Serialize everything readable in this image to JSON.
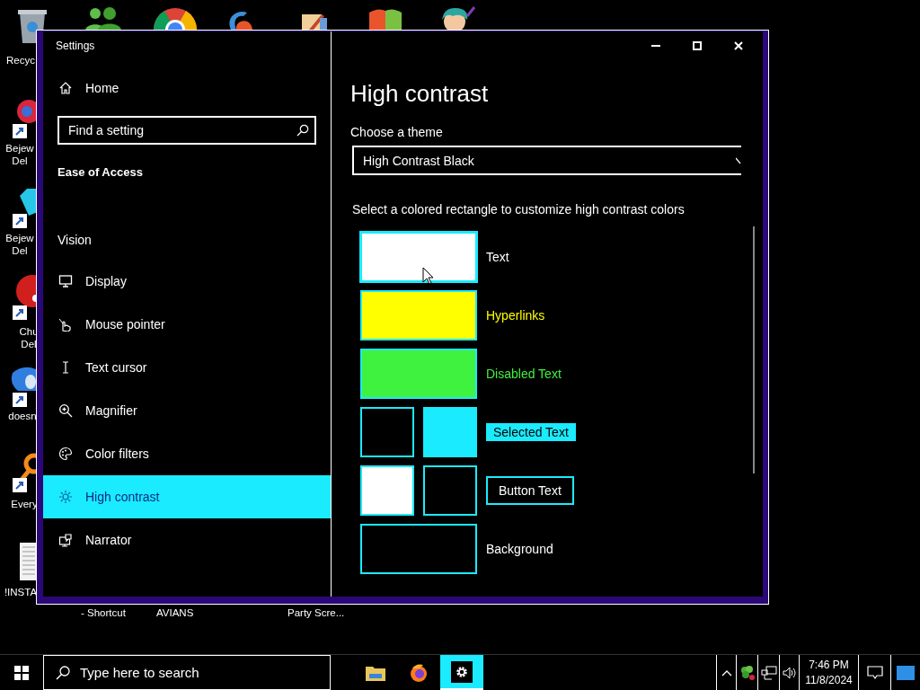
{
  "desktop": {
    "side_labels": [
      {
        "text": "Recyc"
      },
      {
        "text": "Bejew Del"
      },
      {
        "text": "Bejew Del"
      },
      {
        "text": "Chu Del"
      },
      {
        "text": "doesn"
      },
      {
        "text": "Every"
      },
      {
        "text": "!INSTA"
      }
    ],
    "bottom_labels": [
      {
        "text": "- Shortcut"
      },
      {
        "text": "AVIANS"
      },
      {
        "text": "Party Scre..."
      }
    ]
  },
  "window": {
    "title": "Settings"
  },
  "sidebar": {
    "home": "Home",
    "search": {
      "placeholder": "Find a setting"
    },
    "section": "Ease of Access",
    "group": "Vision",
    "items": [
      {
        "label": "Display",
        "selected": false
      },
      {
        "label": "Mouse pointer",
        "selected": false
      },
      {
        "label": "Text cursor",
        "selected": false
      },
      {
        "label": "Magnifier",
        "selected": false
      },
      {
        "label": "Color filters",
        "selected": false
      },
      {
        "label": "High contrast",
        "selected": true
      },
      {
        "label": "Narrator",
        "selected": false
      }
    ]
  },
  "content": {
    "heading": "High contrast",
    "theme_label": "Choose a theme",
    "theme_value": "High Contrast Black",
    "instructions": "Select a colored rectangle to customize high contrast colors",
    "color_rows": [
      {
        "label": "Text",
        "kind": "tinted",
        "swatches": [
          {
            "color": "#ffffff",
            "selected": true
          }
        ]
      },
      {
        "label": "Hyperlinks",
        "kind": "tinted",
        "swatches": [
          {
            "color": "#ffff00",
            "selected": false
          }
        ]
      },
      {
        "label": "Disabled Text",
        "kind": "tinted",
        "swatches": [
          {
            "color": "#3ff23f",
            "selected": false
          }
        ]
      },
      {
        "label": "Selected Text",
        "kind": "selection",
        "swatches": [
          {
            "color": "#000000",
            "selected": false
          },
          {
            "color": "#1aebff",
            "selected": false
          }
        ]
      },
      {
        "label": "Button Text",
        "kind": "button",
        "swatches": [
          {
            "color": "#ffffff",
            "selected": false
          },
          {
            "color": "#000000",
            "selected": false
          }
        ]
      },
      {
        "label": "Background",
        "kind": "plain",
        "swatches": [
          {
            "color": "#000000",
            "selected": false
          }
        ]
      }
    ]
  },
  "taskbar": {
    "search_placeholder": "Type here to search",
    "apps": [
      {
        "selected": false
      },
      {
        "selected": false
      },
      {
        "selected": true
      }
    ],
    "time": "7:46 PM",
    "date": "11/8/2024"
  }
}
